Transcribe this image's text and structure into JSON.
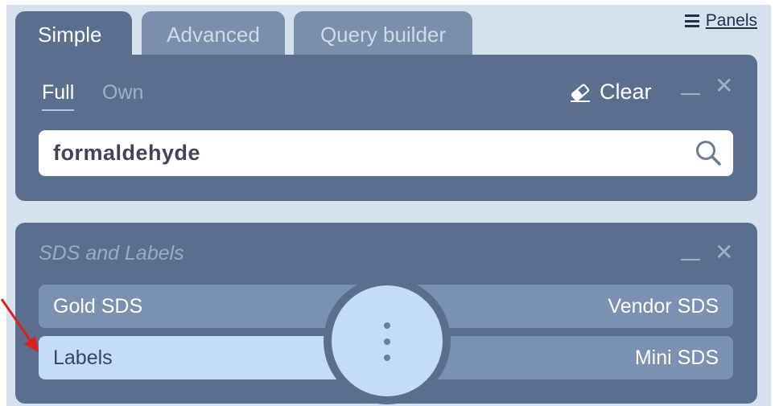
{
  "tabs": [
    {
      "label": "Simple",
      "active": true
    },
    {
      "label": "Advanced",
      "active": false
    },
    {
      "label": "Query builder",
      "active": false
    }
  ],
  "panels_link": {
    "label": "Panels",
    "icon": "hamburger-icon"
  },
  "search_panel": {
    "filters": {
      "full": "Full",
      "own": "Own",
      "selected": "Full"
    },
    "clear_label": "Clear",
    "clear_icon": "eraser-icon",
    "search_value": "formaldehyde",
    "search_icon": "search-icon"
  },
  "sds_panel": {
    "title": "SDS and Labels",
    "options": {
      "gold_sds": "Gold SDS",
      "vendor_sds": "Vendor SDS",
      "labels": "Labels",
      "mini_sds": "Mini SDS"
    },
    "selected": "Labels",
    "menu_icon": "vertical-dots-icon"
  },
  "colors": {
    "panel_bg": "#5a6e8d",
    "inactive_tab": "#7a8fac",
    "option_bg": "#7b91b1",
    "selected_option": "#c4dcf5",
    "page_bg": "#d6e1ee",
    "annotation_arrow": "#e01e1e"
  }
}
